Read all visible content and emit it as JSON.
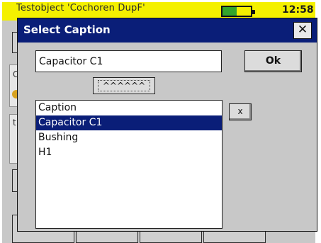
{
  "app": {
    "title": "Testobject 'Cochoren DupF'",
    "clock": "12:58",
    "battery_level": 0.5,
    "colors": {
      "titlebar": "#f4f000",
      "battery_fill": "#33a52c"
    }
  },
  "dialog": {
    "title": "Select Caption",
    "close_label": "✕",
    "caption_value": "Capacitor C1",
    "ok_label": "Ok",
    "tilde_label": "^^^^^^",
    "remove_label": "x",
    "items": [
      {
        "label": "Caption",
        "selected": false
      },
      {
        "label": "Capacitor C1",
        "selected": true
      },
      {
        "label": "Bushing",
        "selected": false
      },
      {
        "label": "H1",
        "selected": false
      }
    ],
    "colors": {
      "titlebar": "#0a1e78",
      "selection": "#0a1e78"
    }
  }
}
